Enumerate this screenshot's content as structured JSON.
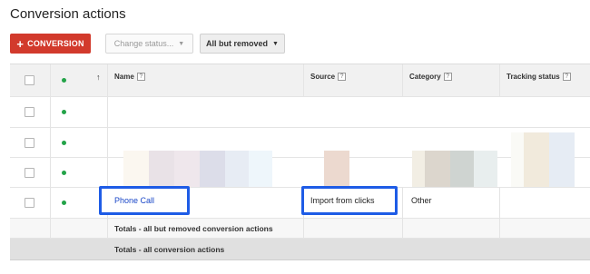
{
  "page": {
    "title": "Conversion actions"
  },
  "toolbar": {
    "add_label": "CONVERSION",
    "add_icon": "plus-icon",
    "status_label": "Change status...",
    "filter_label": "All but removed"
  },
  "table": {
    "headers": {
      "name": "Name",
      "source": "Source",
      "category": "Category",
      "tracking_status": "Tracking status"
    },
    "help_glyph": "?",
    "sort_glyph": "↑",
    "rows": [
      {
        "name": "",
        "source": "",
        "category": ""
      },
      {
        "name": "",
        "source": "",
        "category": ""
      },
      {
        "name": "",
        "source": "",
        "category": ""
      },
      {
        "name": "Phone Call",
        "source": "Import from clicks",
        "category": "Other"
      }
    ],
    "totals": [
      "Totals - all but removed conversion actions",
      "Totals - all conversion actions"
    ]
  },
  "colors": {
    "primary_button": "#d23a2c",
    "highlight_border": "#1e5ce6",
    "status_dot": "#23a348",
    "link": "#1a47c8"
  }
}
